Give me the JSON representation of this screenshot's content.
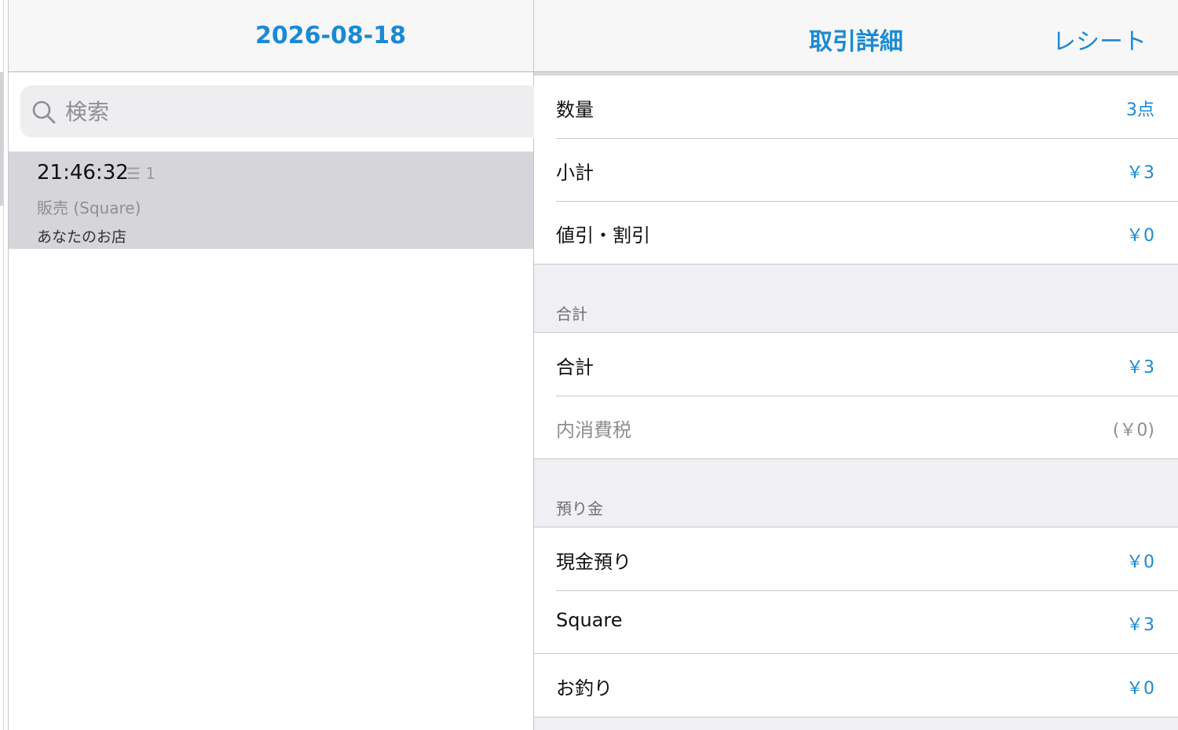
{
  "left": {
    "title": "2026-08-18",
    "search": {
      "placeholder": "検索"
    },
    "transactions": [
      {
        "time": "21:46:32",
        "item_count": "☰ 1",
        "type": "販売 (Square)",
        "store": "あなたのお店"
      }
    ]
  },
  "right": {
    "title": "取引詳細",
    "receipt_label": "レシート",
    "summary": [
      {
        "label": "数量",
        "value": "3点"
      },
      {
        "label": "小計",
        "value": "￥3"
      },
      {
        "label": "値引・割引",
        "value": "￥0"
      }
    ],
    "total_section": {
      "header": "合計",
      "rows": [
        {
          "label": "合計",
          "value": "￥3"
        },
        {
          "label": "内消費税",
          "value": "(￥0)"
        }
      ]
    },
    "deposit_section": {
      "header": "預り金",
      "rows": [
        {
          "label": "現金預り",
          "value": "￥0"
        },
        {
          "label": "Square",
          "value": "￥3"
        }
      ]
    },
    "change_row": {
      "label": "お釣り",
      "value": "￥0"
    }
  },
  "colors": {
    "accent": "#1a8ad4",
    "selected_row": "#d5d5da",
    "grouped_bg": "#efeff4"
  }
}
